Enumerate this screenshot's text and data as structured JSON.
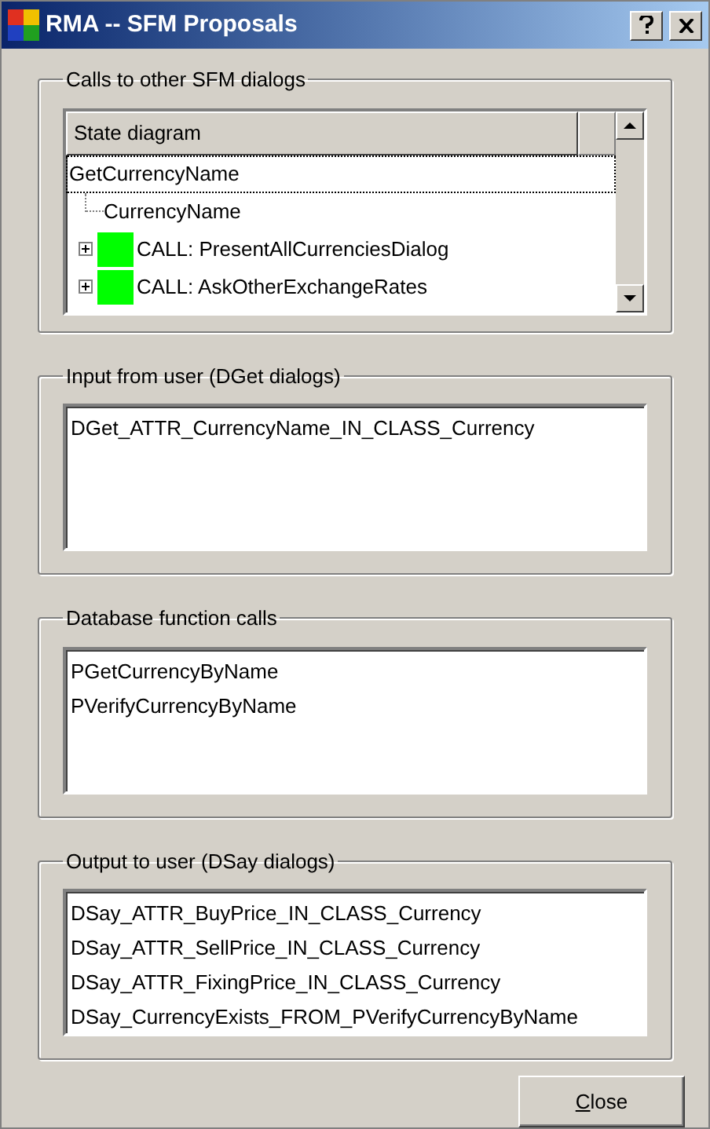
{
  "window": {
    "title": "RMA -- SFM Proposals"
  },
  "calls_group": {
    "legend": "Calls to other SFM dialogs",
    "tree": {
      "column": "State diagram",
      "nodes": [
        {
          "label": "GetCurrencyName",
          "selected": true,
          "children": [
            {
              "label": "CurrencyName",
              "kind": "field"
            },
            {
              "label": "CALL: PresentAllCurrenciesDialog",
              "kind": "call",
              "expanded": false
            },
            {
              "label": "CALL: AskOtherExchangeRates",
              "kind": "call",
              "expanded": false
            }
          ]
        }
      ]
    }
  },
  "input_group": {
    "legend": "Input from user (DGet dialogs)",
    "items": [
      "DGet_ATTR_CurrencyName_IN_CLASS_Currency"
    ]
  },
  "database_group": {
    "legend": "Database function calls",
    "items": [
      "PGetCurrencyByName",
      "PVerifyCurrencyByName"
    ]
  },
  "output_group": {
    "legend": "Output to user (DSay dialogs)",
    "items": [
      "DSay_ATTR_BuyPrice_IN_CLASS_Currency",
      "DSay_ATTR_SellPrice_IN_CLASS_Currency",
      "DSay_ATTR_FixingPrice_IN_CLASS_Currency",
      "DSay_CurrencyExists_FROM_PVerifyCurrencyByName"
    ]
  },
  "close_button": {
    "label": "Close",
    "first_letter_underlined": true
  }
}
